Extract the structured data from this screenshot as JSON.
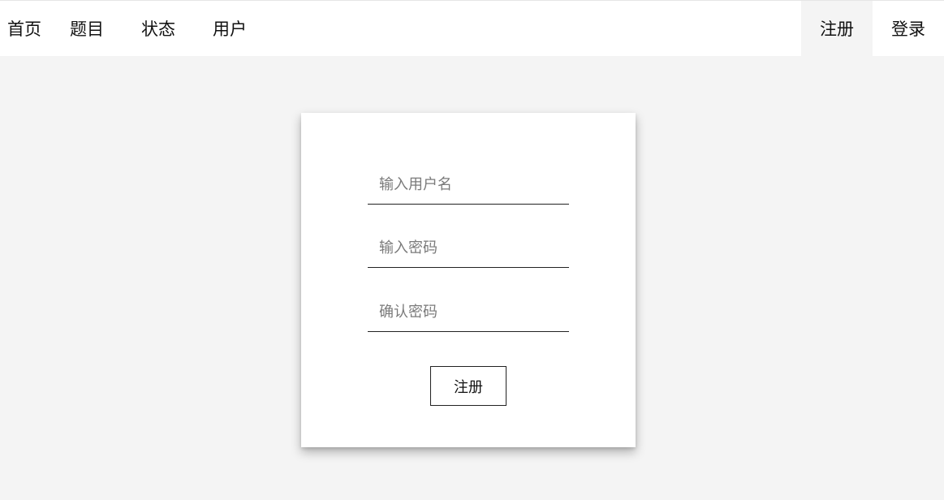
{
  "navbar": {
    "left_items": [
      {
        "label": "首页"
      },
      {
        "label": "题目"
      },
      {
        "label": "状态"
      },
      {
        "label": "用户"
      }
    ],
    "right_items": [
      {
        "label": "注册",
        "active": true
      },
      {
        "label": "登录",
        "active": false
      }
    ]
  },
  "register_form": {
    "username": {
      "value": "",
      "placeholder": "输入用户名"
    },
    "password": {
      "value": "",
      "placeholder": "输入密码"
    },
    "confirm_password": {
      "value": "",
      "placeholder": "确认密码"
    },
    "submit_label": "注册"
  }
}
